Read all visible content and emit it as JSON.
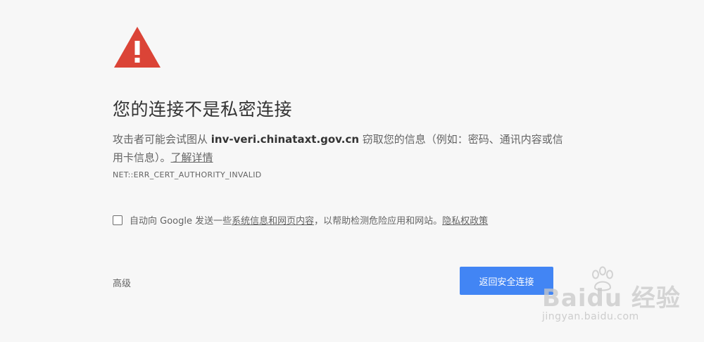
{
  "heading": "您的连接不是私密连接",
  "description": {
    "prefix": "攻击者可能会试图从 ",
    "host": "inv-veri.chinataxt.gov.cn",
    "suffix": " 窃取您的信息（例如：密码、通讯内容或信用卡信息）。",
    "learn_more": "了解详情"
  },
  "error_code": "NET::ERR_CERT_AUTHORITY_INVALID",
  "report": {
    "checked": false,
    "prefix": "自动向 Google 发送一些",
    "link1": "系统信息和网页内容",
    "middle": "，以帮助检测危险应用和网站。",
    "link2": "隐私权政策"
  },
  "advanced_label": "高级",
  "back_button_label": "返回安全连接",
  "watermark": {
    "logo": "Baidu 经验",
    "url": "jingyan.baidu.com"
  },
  "colors": {
    "warning": "#db4437",
    "button": "#4285f4",
    "background": "#f7f7f7"
  }
}
